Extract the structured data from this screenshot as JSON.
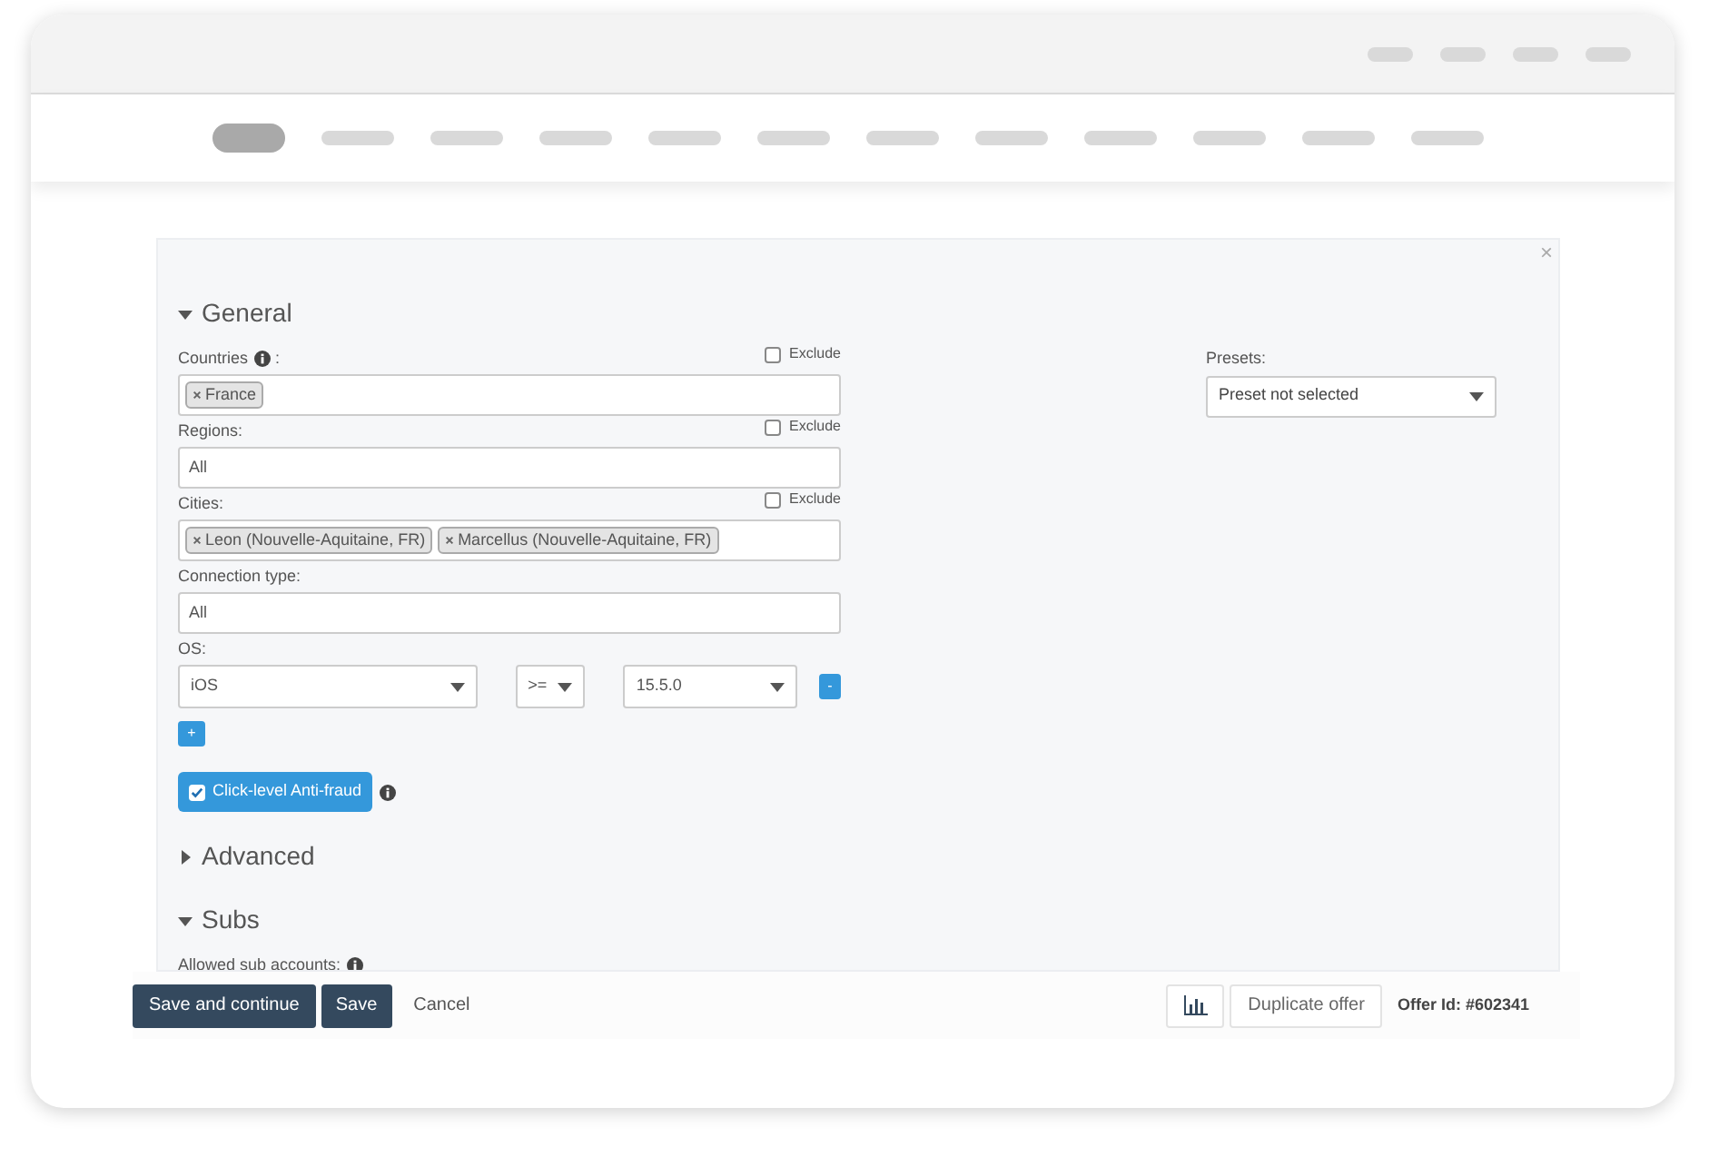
{
  "nav": [
    {
      "selected": true
    },
    {
      "selected": false
    },
    {
      "selected": false
    },
    {
      "selected": false
    },
    {
      "selected": false
    },
    {
      "selected": false
    },
    {
      "selected": false
    },
    {
      "selected": false
    },
    {
      "selected": false
    },
    {
      "selected": false
    },
    {
      "selected": false
    },
    {
      "selected": false
    }
  ],
  "panel": {
    "close": "×",
    "sections": [
      {
        "title": "General",
        "expanded": true,
        "fields": [
          {
            "kind": "tags",
            "label": "Countries",
            "info": true,
            "suffix": ":",
            "exclude": {
              "label": "Exclude",
              "checked": false
            },
            "tags": [
              "France"
            ]
          },
          {
            "kind": "text",
            "label": "Regions:",
            "exclude": {
              "label": "Exclude",
              "checked": false
            },
            "value": "All"
          },
          {
            "kind": "tags",
            "label": "Cities:",
            "exclude": {
              "label": "Exclude",
              "checked": false
            },
            "tags": [
              "Leon (Nouvelle-Aquitaine, FR)",
              "Marcellus (Nouvelle-Aquitaine, FR)"
            ]
          },
          {
            "kind": "text",
            "label": "Connection type:",
            "value": "All"
          },
          {
            "kind": "os",
            "label": "OS:",
            "os": "iOS",
            "operator": ">=",
            "version": "15.5.0",
            "remove": "-",
            "add": "+"
          },
          {
            "kind": "toggle",
            "label": "Click-level Anti-fraud",
            "checked": true,
            "info": true
          }
        ]
      },
      {
        "title": "Advanced",
        "expanded": false
      },
      {
        "title": "Subs",
        "expanded": true,
        "fields": [
          {
            "kind": "label",
            "label": "Allowed sub accounts:",
            "info": true
          }
        ]
      }
    ],
    "presets": {
      "label": "Presets:",
      "value": "Preset not selected"
    }
  },
  "footer": {
    "save_continue": "Save and continue",
    "save": "Save",
    "cancel": "Cancel",
    "duplicate": "Duplicate offer",
    "offer_id": "Offer Id: #602341"
  }
}
